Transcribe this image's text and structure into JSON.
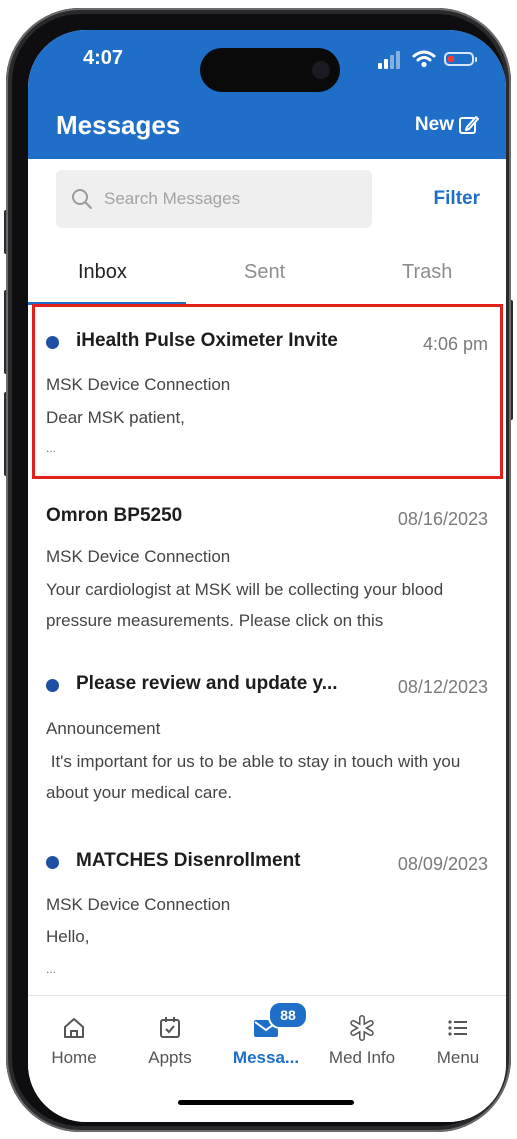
{
  "status_bar": {
    "time": "4:07"
  },
  "header": {
    "title": "Messages",
    "new_label": "New"
  },
  "search": {
    "placeholder": "Search Messages",
    "filter_label": "Filter"
  },
  "tabs": [
    {
      "label": "Inbox",
      "active": true
    },
    {
      "label": "Sent",
      "active": false
    },
    {
      "label": "Trash",
      "active": false
    }
  ],
  "messages": [
    {
      "unread": true,
      "subject": "iHealth Pulse Oximeter Invite",
      "date": "4:06 pm",
      "category": "MSK Device Connection",
      "preview": "Dear MSK patient,",
      "ellipsis": "..."
    },
    {
      "unread": false,
      "subject": "Omron BP5250",
      "date": "08/16/2023",
      "category": "MSK Device Connection",
      "preview": "Your cardiologist at MSK will be collecting your blood pressure measurements. Please click on this",
      "ellipsis": ""
    },
    {
      "unread": true,
      "subject": "Please review and update y...",
      "date": "08/12/2023",
      "category": "Announcement",
      "preview": " It's important for us to be able to stay in touch with you about your medical care.",
      "ellipsis": ""
    },
    {
      "unread": true,
      "subject": "MATCHES Disenrollment",
      "date": "08/09/2023",
      "category": "MSK Device Connection",
      "preview": "Hello,",
      "ellipsis": "..."
    }
  ],
  "tabbar": {
    "items": [
      {
        "label": "Home",
        "icon": "home-icon"
      },
      {
        "label": "Appts",
        "icon": "calendar-check-icon"
      },
      {
        "label": "Messa...",
        "icon": "envelope-icon",
        "badge": "88",
        "active": true
      },
      {
        "label": "Med Info",
        "icon": "medical-cross-icon"
      },
      {
        "label": "Menu",
        "icon": "list-menu-icon"
      }
    ]
  },
  "colors": {
    "brand_blue": "#1f6fc9",
    "unread_dot": "#1f4fa3",
    "highlight_red": "#e3201b"
  }
}
